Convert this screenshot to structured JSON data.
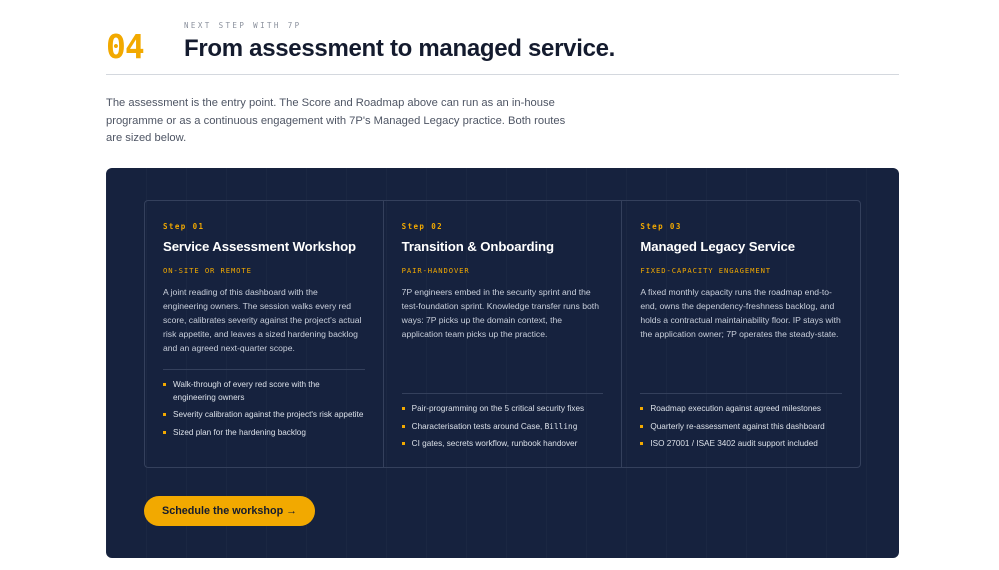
{
  "header": {
    "section_number": "04",
    "eyebrow": "NEXT STEP WITH 7P",
    "title": "From assessment to managed service."
  },
  "intro": "The assessment is the entry point. The Score and Roadmap above can run as an in-house programme or as a continuous engagement with 7P's Managed Legacy practice. Both routes are sized below.",
  "steps": [
    {
      "label": "Step 01",
      "title": "Service Assessment Workshop",
      "tag": "ON-SITE OR REMOTE",
      "description": "A joint reading of this dashboard with the engineering owners. The session walks every red score, calibrates severity against the project's actual risk appetite, and leaves a sized hardening backlog and an agreed next-quarter scope.",
      "bullets": [
        "Walk-through of every red score with the engineering owners",
        "Severity calibration against the project's risk appetite",
        "Sized plan for the hardening backlog"
      ]
    },
    {
      "label": "Step 02",
      "title": "Transition & Onboarding",
      "tag": "PAIR-HANDOVER",
      "description": "7P engineers embed in the security sprint and the test-foundation sprint. Knowledge transfer runs both ways: 7P picks up the domain context, the application team picks up the practice.",
      "bullets": [
        "Pair-programming on the 5 critical security fixes",
        "Characterisation tests around Case, ",
        "CI gates, secrets workflow, runbook handover"
      ],
      "bullet_code": "Billing"
    },
    {
      "label": "Step 03",
      "title": "Managed Legacy Service",
      "tag": "FIXED-CAPACITY ENGAGEMENT",
      "description": "A fixed monthly capacity runs the roadmap end-to-end, owns the dependency-freshness backlog, and holds a contractual maintainability floor. IP stays with the application owner; 7P operates the steady-state.",
      "bullets": [
        "Roadmap execution against agreed milestones",
        "Quarterly re-assessment against this dashboard",
        "ISO 27001 / ISAE 3402 audit support included"
      ]
    }
  ],
  "cta": {
    "label": "Schedule the workshop →"
  },
  "colors": {
    "accent": "#f2a900",
    "panel": "#16223e",
    "title": "#141b2e"
  }
}
